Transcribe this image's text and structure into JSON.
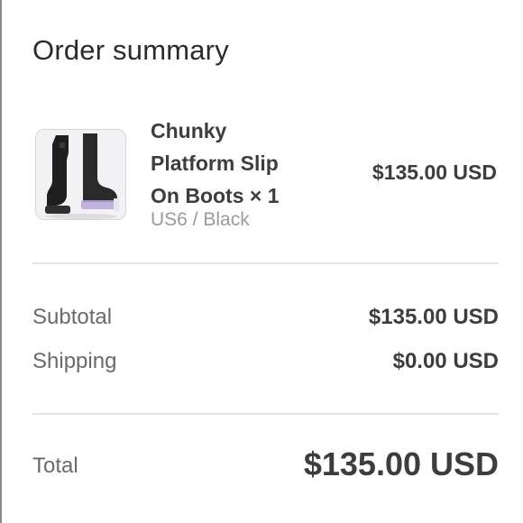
{
  "summary": {
    "title": "Order summary"
  },
  "item": {
    "name": "Chunky Platform Slip On Boots × 1",
    "variant": "US6 / Black",
    "price": "$135.00 USD",
    "image_icon": "boots-thumbnail"
  },
  "lines": {
    "subtotal_label": "Subtotal",
    "subtotal_value": "$135.00 USD",
    "shipping_label": "Shipping",
    "shipping_value": "$0.00 USD"
  },
  "total": {
    "label": "Total",
    "value": "$135.00 USD"
  }
}
